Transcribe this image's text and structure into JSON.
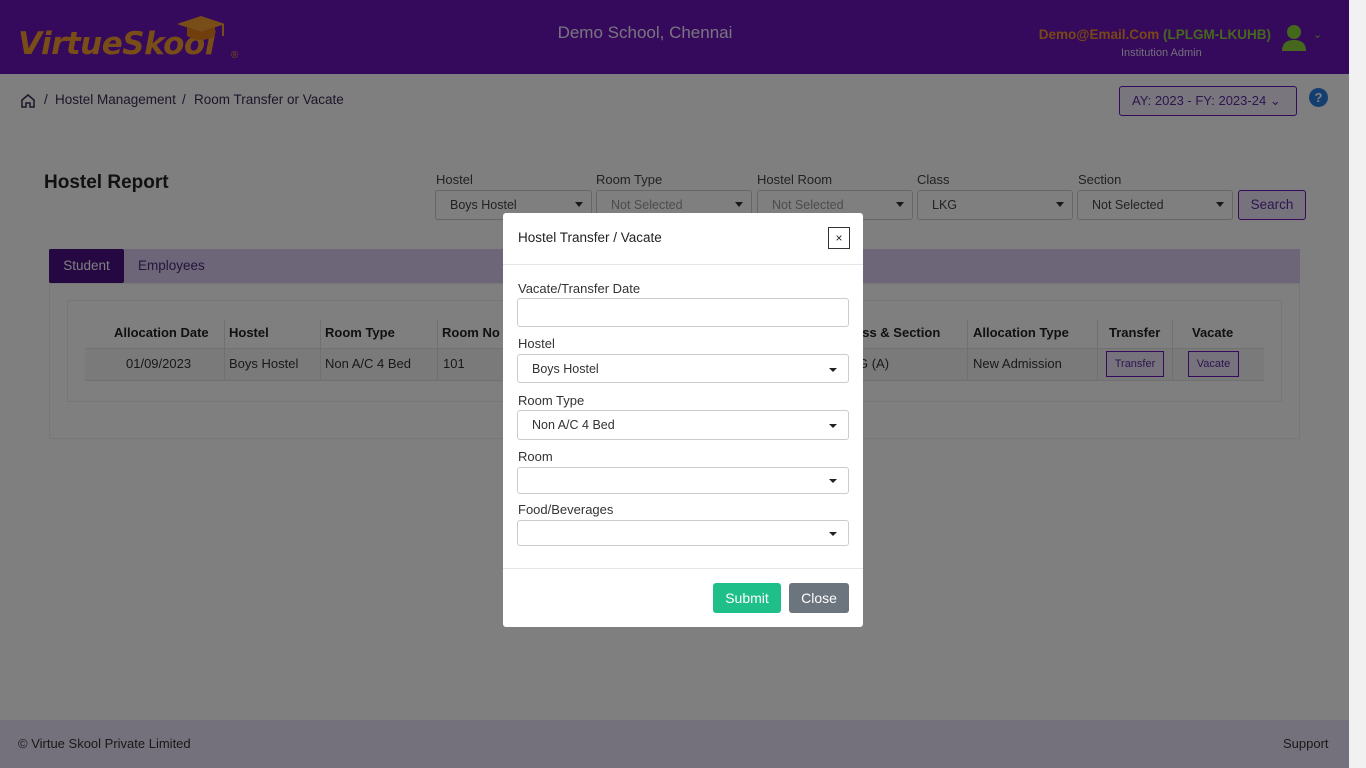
{
  "header": {
    "logo_part1": "Virtue",
    "logo_part2": "Skool",
    "logo_reg": "®",
    "school_name": "Demo School, Chennai",
    "user_email": "Demo@Email.Com",
    "user_code": "(LPLGM-LKUHB)",
    "user_role": "Institution Admin"
  },
  "breadcrumb": {
    "sep": "/",
    "items": [
      "Hostel Management",
      "Room Transfer or Vacate"
    ]
  },
  "academic_year": "AY: 2023 - FY: 2023-24",
  "help_icon": "?",
  "page_title": "Hostel Report",
  "filters": [
    {
      "label": "Hostel",
      "value": "Boys Hostel"
    },
    {
      "label": "Room Type",
      "value": "Not Selected"
    },
    {
      "label": "Hostel Room",
      "value": "Not Selected"
    },
    {
      "label": "Class",
      "value": "LKG"
    },
    {
      "label": "Section",
      "value": "Not Selected"
    }
  ],
  "search_label": "Search",
  "tabs": [
    "Student",
    "Employees"
  ],
  "table": {
    "headers": [
      "Allocation Date",
      "Hostel",
      "Room Type",
      "Room No",
      "Class & Section",
      "Allocation Type",
      "Transfer",
      "Vacate"
    ],
    "visible_headers": {
      "class_section": "ass & Section"
    },
    "row": {
      "allocation_date": "01/09/2023",
      "hostel": "Boys Hostel",
      "room_type": "Non A/C 4 Bed",
      "room_no": "101",
      "class_section": "G (A)",
      "allocation_type": "New Admission",
      "transfer_btn": "Transfer",
      "vacate_btn": "Vacate"
    }
  },
  "footer": {
    "copyright": "© Virtue Skool Private Limited",
    "support": "Support"
  },
  "modal": {
    "title": "Hostel Transfer / Vacate",
    "close_x": "×",
    "fields": {
      "date_label": "Vacate/Transfer Date",
      "date_value": "",
      "hostel_label": "Hostel",
      "hostel_value": "Boys Hostel",
      "room_type_label": "Room Type",
      "room_type_value": "Non A/C 4 Bed",
      "room_label": "Room",
      "room_value": "",
      "food_label": "Food/Beverages",
      "food_value": ""
    },
    "submit_label": "Submit",
    "close_label": "Close"
  },
  "colors": {
    "header_bg": "#6a12b8",
    "accent": "#f29a2e",
    "submit": "#1fbf8a",
    "close": "#6c757d"
  }
}
